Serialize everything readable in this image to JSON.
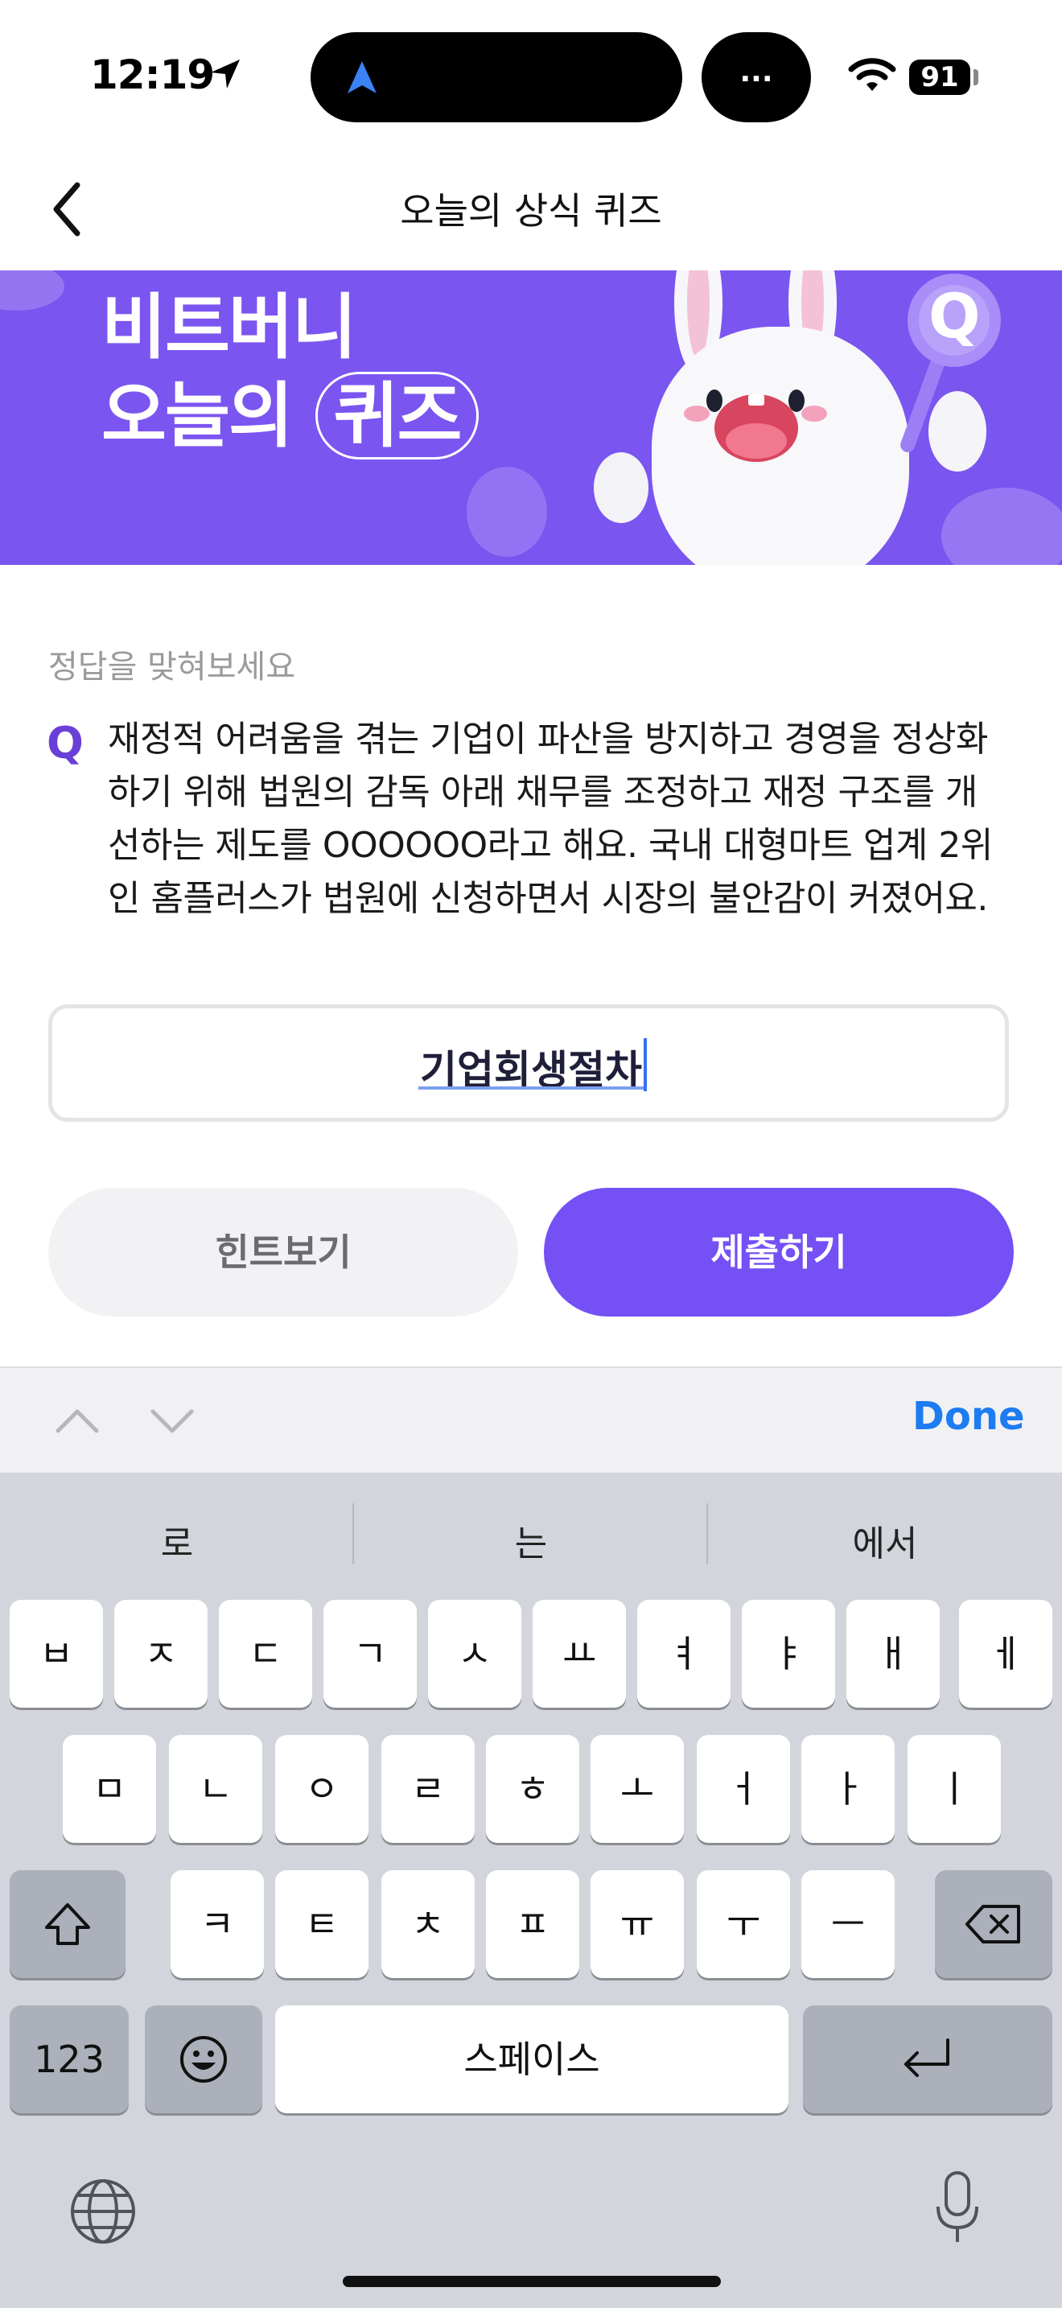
{
  "status_bar": {
    "time": "12:19",
    "pill_label": "...",
    "battery": "91"
  },
  "nav": {
    "title": "오늘의 상식 퀴즈"
  },
  "banner": {
    "line1": "비트버니",
    "line2_prefix": "오늘의 ",
    "line2_highlight": "퀴즈",
    "badge": "Q"
  },
  "question": {
    "prompt": "정답을 맞혀보세요",
    "mark": "Q",
    "lines": [
      "재정적 어려움을 겪는 기업이 파산을 방지하고 경영을 정상화",
      "하기 위해 법원의 감독 아래 채무를 조정하고 재정 구조를 개",
      "선하는 제도를 OOOOOO라고 해요. 국내 대형마트 업계 2위",
      "인 홈플러스가 법원에 신청하면서 시장의 불안감이 커졌어요."
    ]
  },
  "answer": {
    "value": "기업회생절차"
  },
  "buttons": {
    "hint": "힌트보기",
    "submit": "제출하기"
  },
  "accessory": {
    "done": "Done"
  },
  "keyboard": {
    "suggestions": [
      "로",
      "는",
      "에서"
    ],
    "row1": [
      "ㅂ",
      "ㅈ",
      "ㄷ",
      "ㄱ",
      "ㅅ",
      "ㅛ",
      "ㅕ",
      "ㅑ",
      "ㅐ",
      "ㅔ"
    ],
    "row2": [
      "ㅁ",
      "ㄴ",
      "ㅇ",
      "ㄹ",
      "ㅎ",
      "ㅗ",
      "ㅓ",
      "ㅏ",
      "ㅣ"
    ],
    "row3": [
      "ㅋ",
      "ㅌ",
      "ㅊ",
      "ㅍ",
      "ㅠ",
      "ㅜ",
      "ㅡ"
    ],
    "numbers_label": "123",
    "space_label": "스페이스"
  },
  "colors": {
    "accent": "#7550f5",
    "banner": "#7b55f0",
    "done": "#1d7cf2"
  }
}
